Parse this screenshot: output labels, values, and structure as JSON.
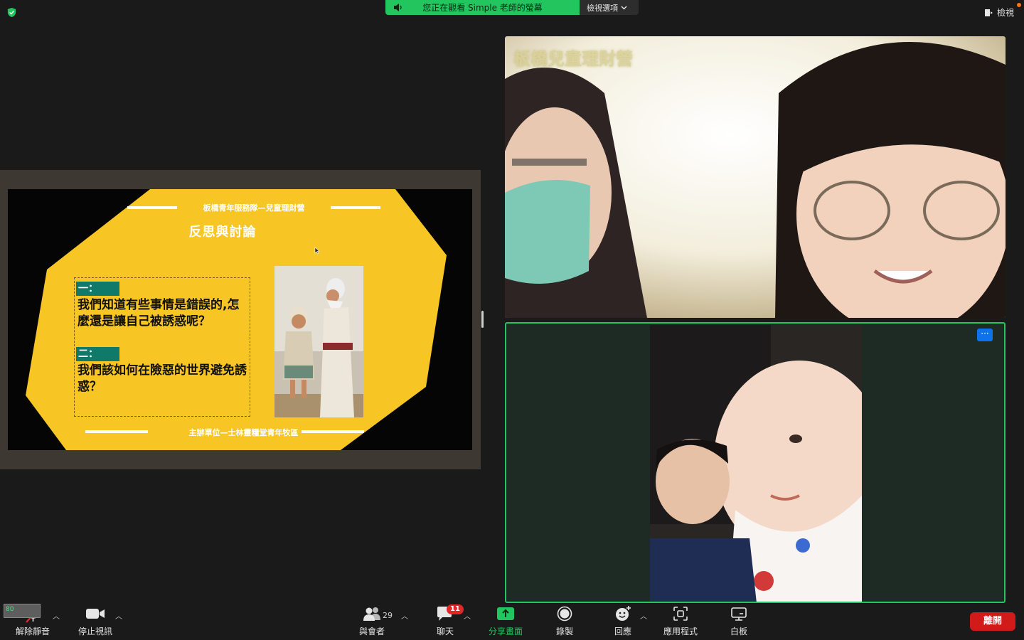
{
  "top": {
    "share_status": "您正在觀看 Simple 老師的螢幕",
    "view_options": "檢視選項",
    "view": "檢視"
  },
  "slide": {
    "header": "板橋青年服務隊—兒童理財營",
    "title": "反思與討論",
    "q1_label": "一：",
    "q1_text": "我們知道有些事情是錯誤的,怎麼還是讓自己被誘惑呢？",
    "q2_label": "二：",
    "q2_text": "我們該如何在險惡的世界避免誘惑？",
    "footer": "主辦單位—士林靈糧堂青年牧區"
  },
  "video": {
    "top_watermark": "板橋兒童理財營",
    "more": "···"
  },
  "toolbar": {
    "self_label": "80",
    "unmute": "解除靜音",
    "stop_video": "停止視訊",
    "participants": "與會者",
    "participants_count": "29",
    "chat": "聊天",
    "chat_badge": "11",
    "share_screen": "分享畫面",
    "record": "錄製",
    "reactions": "回應",
    "apps": "應用程式",
    "whiteboard": "白板",
    "leave": "離開"
  },
  "colors": {
    "share_green": "#22c55e",
    "slide_yellow": "#f7c624",
    "leave_red": "#d11a1a",
    "active_border": "#22c55e",
    "accent_blue": "#0e72ed"
  }
}
